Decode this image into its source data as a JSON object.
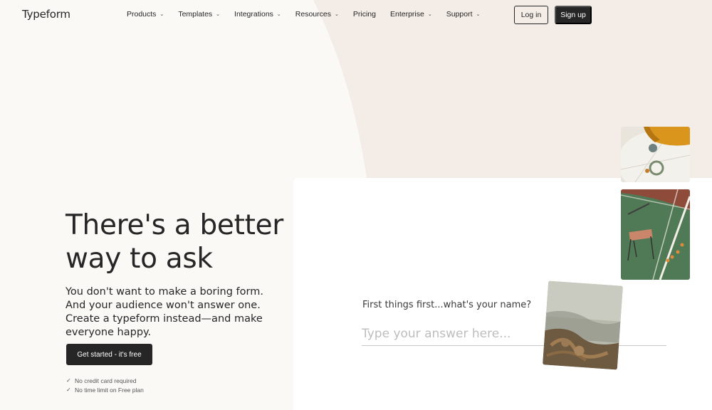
{
  "nav": {
    "logo": "Typeform",
    "items": [
      {
        "label": "Products",
        "has_dropdown": true
      },
      {
        "label": "Templates",
        "has_dropdown": true
      },
      {
        "label": "Integrations",
        "has_dropdown": true
      },
      {
        "label": "Resources",
        "has_dropdown": true
      },
      {
        "label": "Pricing",
        "has_dropdown": false
      },
      {
        "label": "Enterprise",
        "has_dropdown": true
      },
      {
        "label": "Support",
        "has_dropdown": true
      }
    ],
    "login_label": "Log in",
    "signup_label": "Sign up"
  },
  "hero": {
    "headline": "There's a better way to ask",
    "subtext": "You don't want to make a boring form. And your audience won't answer one. Create a typeform instead—and make everyone happy.",
    "cta_label": "Get started - it's free",
    "perks": [
      "No credit card required",
      "No time limit on Free plan"
    ]
  },
  "form_card": {
    "question": "First things first...what's your name?",
    "answer_placeholder": "Type your answer here..."
  },
  "colors": {
    "background": "#faf9f6",
    "accent_shape": "#f3ebe5",
    "dark": "#262627"
  },
  "icons": [
    "chevron-down-icon",
    "check-icon"
  ]
}
